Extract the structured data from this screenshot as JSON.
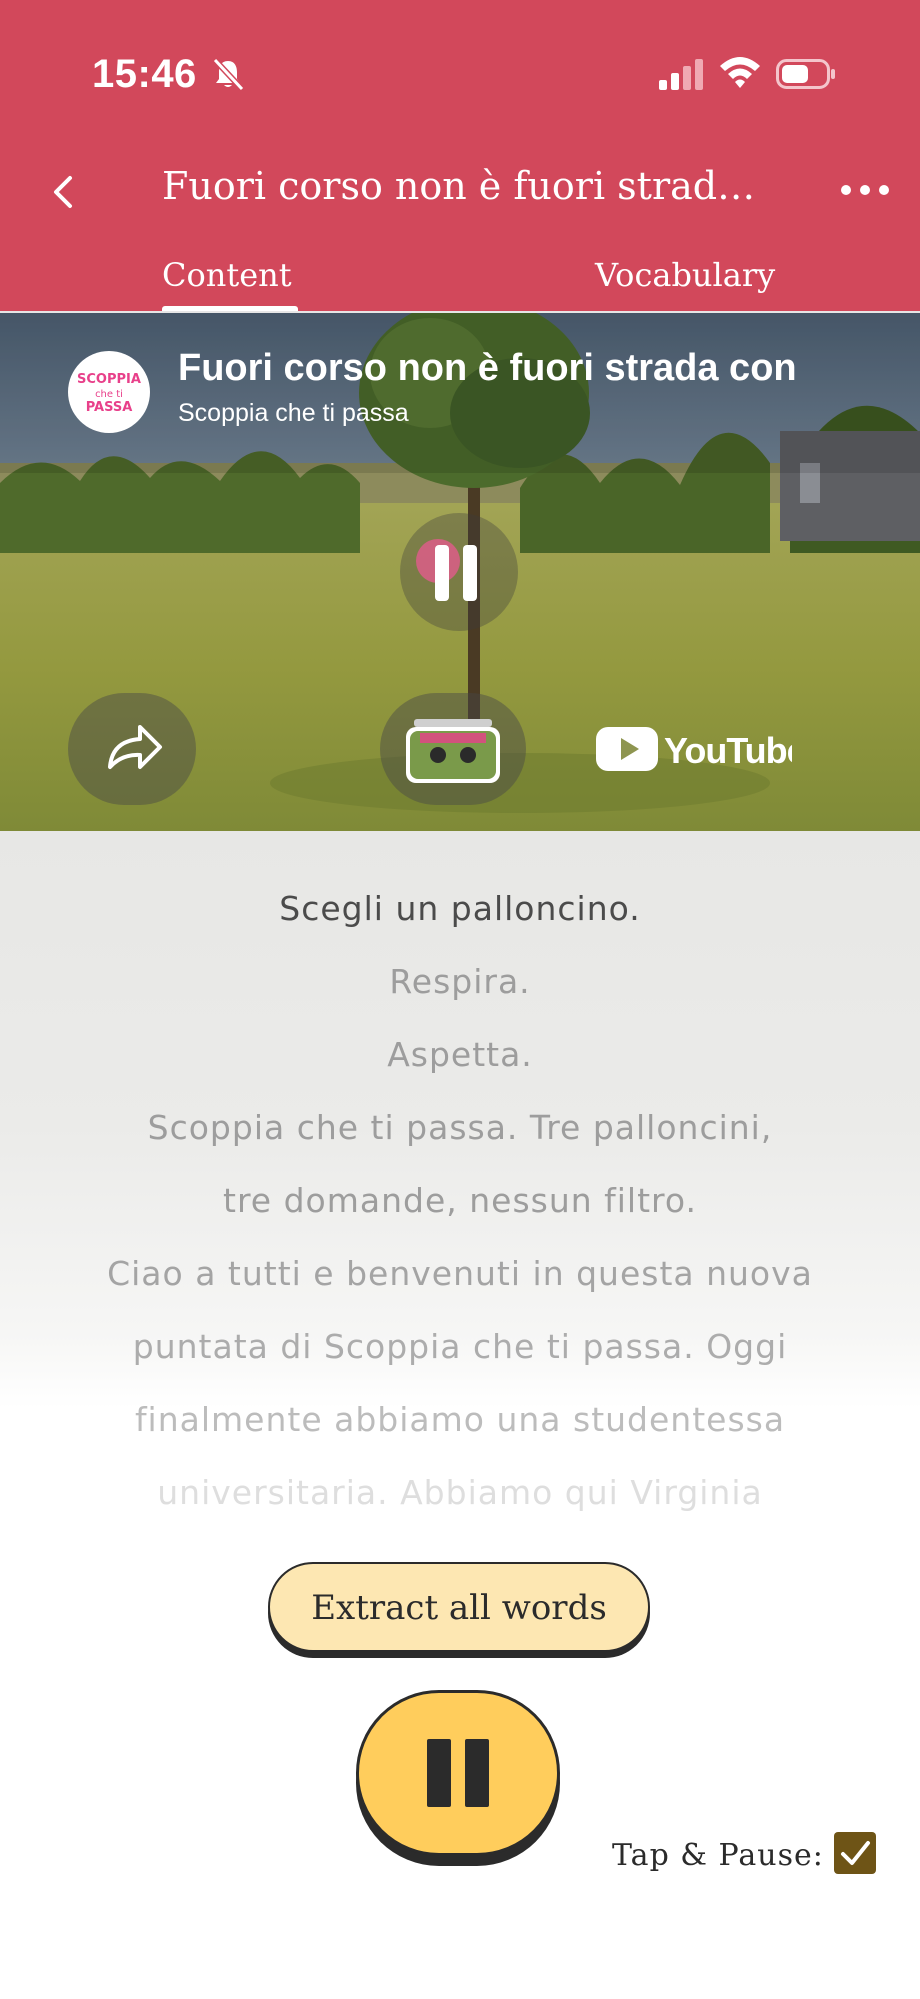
{
  "status_bar": {
    "time": "15:46"
  },
  "header": {
    "title": "Fuori corso non è fuori strada c...",
    "tabs": [
      {
        "label": "Content",
        "active": true
      },
      {
        "label": "Vocabulary",
        "active": false
      }
    ]
  },
  "video": {
    "title": "Fuori corso non è fuori strada con",
    "channel": "Scoppia che ti passa",
    "avatar_text": [
      "SCOPPIA",
      "che ti",
      "PASSA"
    ],
    "brand": "YouTube"
  },
  "transcript": {
    "lines": [
      "Scegli un palloncino.",
      "Respira.",
      "Aspetta.",
      "Scoppia che ti passa. Tre palloncini,",
      "tre domande, nessun filtro.",
      "Ciao a tutti e benvenuti in questa nuova",
      "puntata di Scoppia che ti passa. Oggi",
      "finalmente abbiamo una studentessa",
      "universitaria. Abbiamo qui Virginia"
    ]
  },
  "controls": {
    "extract_label": "Extract all words",
    "tap_pause_label": "Tap & Pause:",
    "tap_pause_checked": true
  },
  "colors": {
    "header": "#d2485b",
    "extract_button": "#fde7b2",
    "pause_button": "#ffcd5c",
    "checkbox": "#6e5416"
  },
  "icons": [
    "bell-slash-icon",
    "signal-icon",
    "wifi-icon",
    "battery-icon",
    "back-icon",
    "more-icon",
    "pause-icon",
    "share-icon",
    "youtube-logo",
    "checkmark-icon"
  ]
}
